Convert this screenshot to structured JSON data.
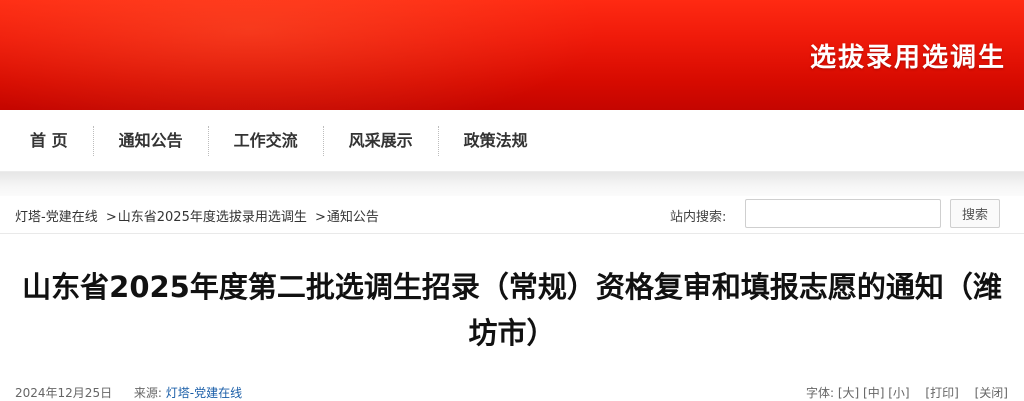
{
  "header": {
    "title": "选拔录用选调生"
  },
  "nav": {
    "items": [
      {
        "label": "首 页"
      },
      {
        "label": "通知公告"
      },
      {
        "label": "工作交流"
      },
      {
        "label": "风采展示"
      },
      {
        "label": "政策法规"
      }
    ]
  },
  "breadcrumb": {
    "items": [
      "灯塔-党建在线",
      "山东省2025年度选拔录用选调生",
      "通知公告"
    ],
    "separator": ">"
  },
  "search": {
    "label": "站内搜索:",
    "value": "",
    "button_label": "搜索"
  },
  "article": {
    "title": "山东省2025年度第二批选调生招录（常规）资格复审和填报志愿的通知（潍坊市）",
    "date": "2024年12月25日",
    "source_label": "来源:",
    "source": "灯塔-党建在线"
  },
  "tools": {
    "font_label": "字体:",
    "large": "[大]",
    "medium": "[中]",
    "small": "[小]",
    "print": "[打印]",
    "close": "[关闭]"
  },
  "colors": {
    "banner_red": "#e0140a",
    "link_blue": "#1a5ea8"
  }
}
